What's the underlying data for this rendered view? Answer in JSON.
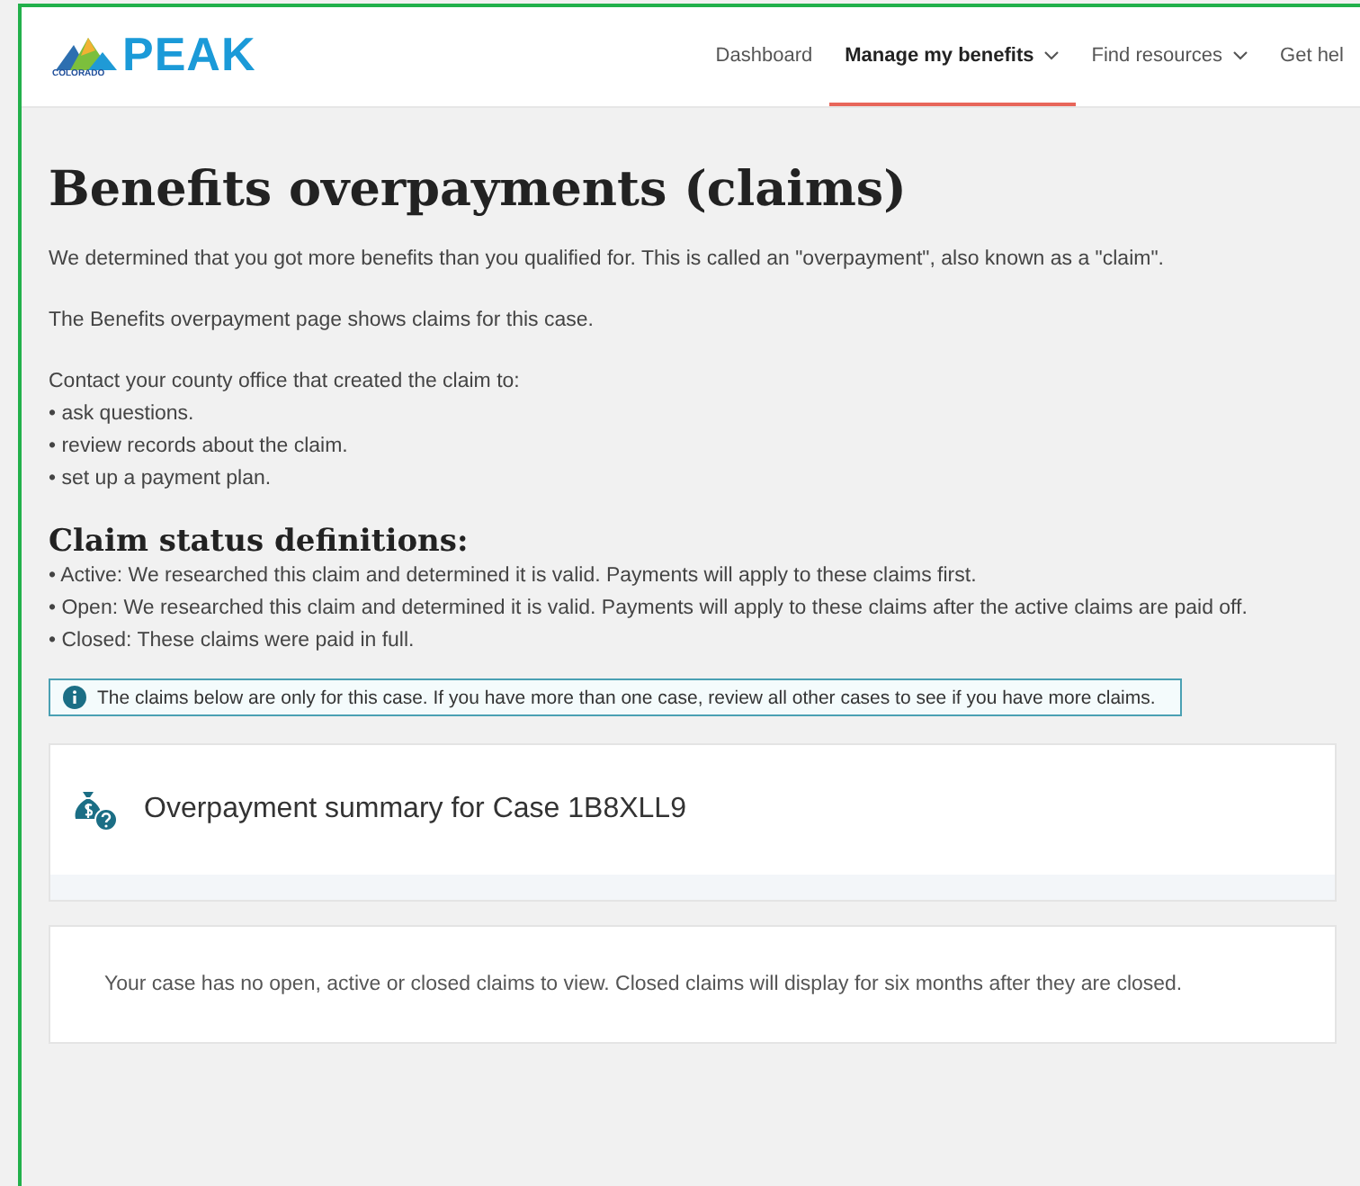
{
  "header": {
    "logo": {
      "small_text": "COLORADO",
      "name": "PEAK"
    },
    "nav": [
      {
        "label": "Dashboard",
        "selected": false,
        "dropdown": false
      },
      {
        "label": "Manage my benefits",
        "selected": true,
        "dropdown": true
      },
      {
        "label": "Find resources",
        "selected": false,
        "dropdown": true
      },
      {
        "label": "Get hel",
        "selected": false,
        "dropdown": false
      }
    ]
  },
  "title": "Benefits overpayments (claims)",
  "intro": [
    "We determined that you got more benefits than you qualified for. This is called an \"overpayment\", also known as a \"claim\".",
    "The Benefits overpayment page shows claims for this case."
  ],
  "contact": {
    "lead": "Contact your county office that created the claim to:",
    "items": [
      "• ask questions.",
      "• review records about the claim.",
      "• set up a payment plan."
    ]
  },
  "definitions": {
    "heading": "Claim status definitions:",
    "items": [
      "• Active: We researched this claim and determined it is valid. Payments will apply to these claims first.",
      "• Open: We researched this claim and determined it is valid. Payments will apply to these claims after the active claims are paid off.",
      "• Closed: These claims were paid in full."
    ]
  },
  "notice": "The claims below are only for this case. If you have more than one case, review all other cases to see if you have more claims.",
  "summary": {
    "title": "Overpayment summary for Case 1B8XLL9"
  },
  "empty_message": "Your case has no open, active or closed claims to view. Closed claims will display for six months after they are closed."
}
